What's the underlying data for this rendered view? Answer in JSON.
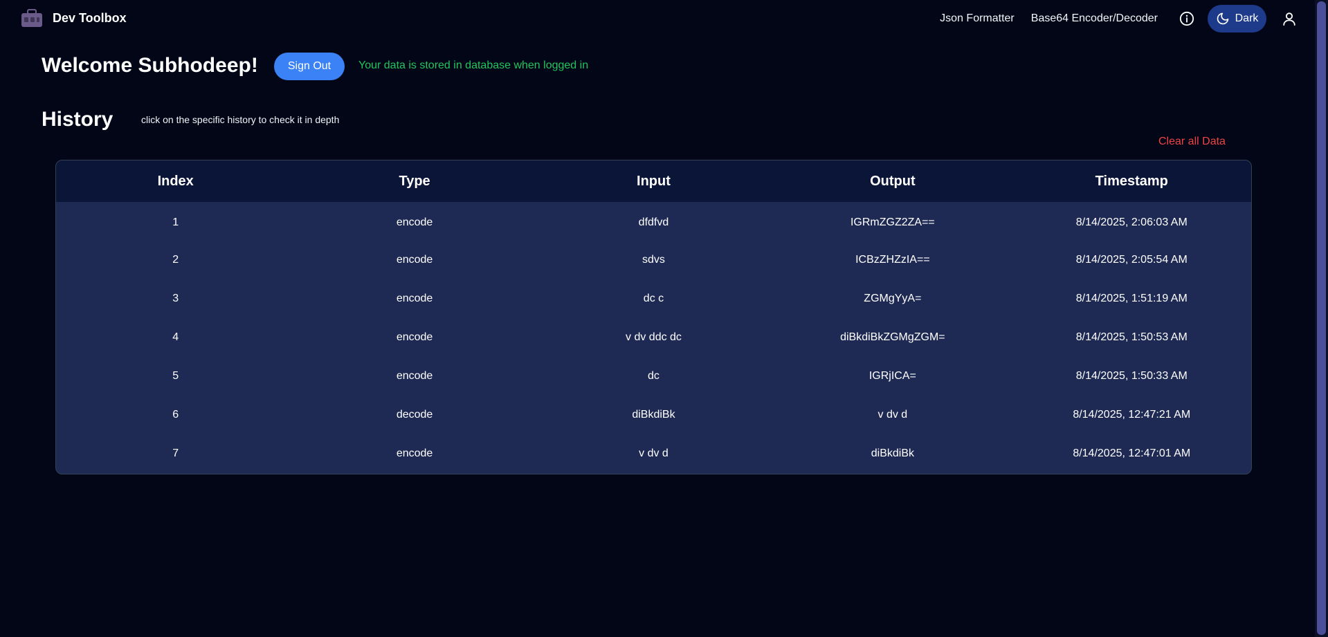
{
  "nav": {
    "brand": "Dev Toolbox",
    "links": [
      "Json Formatter",
      "Base64 Encoder/Decoder"
    ],
    "theme_label": "Dark"
  },
  "welcome": {
    "title": "Welcome Subhodeep!",
    "signout_label": "Sign Out",
    "db_note": "Your data is stored in database when logged in"
  },
  "history": {
    "title": "History",
    "hint": "click on the specific history to check it in depth",
    "clear_label": "Clear all Data",
    "columns": [
      "Index",
      "Type",
      "Input",
      "Output",
      "Timestamp"
    ],
    "rows": [
      [
        "1",
        "encode",
        "dfdfvd",
        "IGRmZGZ2ZA==",
        "8/14/2025, 2:06:03 AM"
      ],
      [
        "2",
        "encode",
        "sdvs",
        "ICBzZHZzIA==",
        "8/14/2025, 2:05:54 AM"
      ],
      [
        "3",
        "encode",
        "dc c",
        "ZGMgYyA=",
        "8/14/2025, 1:51:19 AM"
      ],
      [
        "4",
        "encode",
        "v dv ddc dc",
        "diBkdiBkZGMgZGM=",
        "8/14/2025, 1:50:53 AM"
      ],
      [
        "5",
        "encode",
        "dc",
        "IGRjICA=",
        "8/14/2025, 1:50:33 AM"
      ],
      [
        "6",
        "decode",
        "diBkdiBk",
        "v dv d",
        "8/14/2025, 12:47:21 AM"
      ],
      [
        "7",
        "encode",
        "v dv d",
        "diBkdiBk",
        "8/14/2025, 12:47:01 AM"
      ]
    ]
  },
  "colors": {
    "background": "#020617",
    "accent": "#3b82f6",
    "success": "#22c55e",
    "danger": "#ef4444",
    "table_body": "#1e2a54",
    "table_header": "#0b1538"
  },
  "icons": [
    "toolbox-icon",
    "info-icon",
    "moon-icon",
    "user-icon"
  ]
}
